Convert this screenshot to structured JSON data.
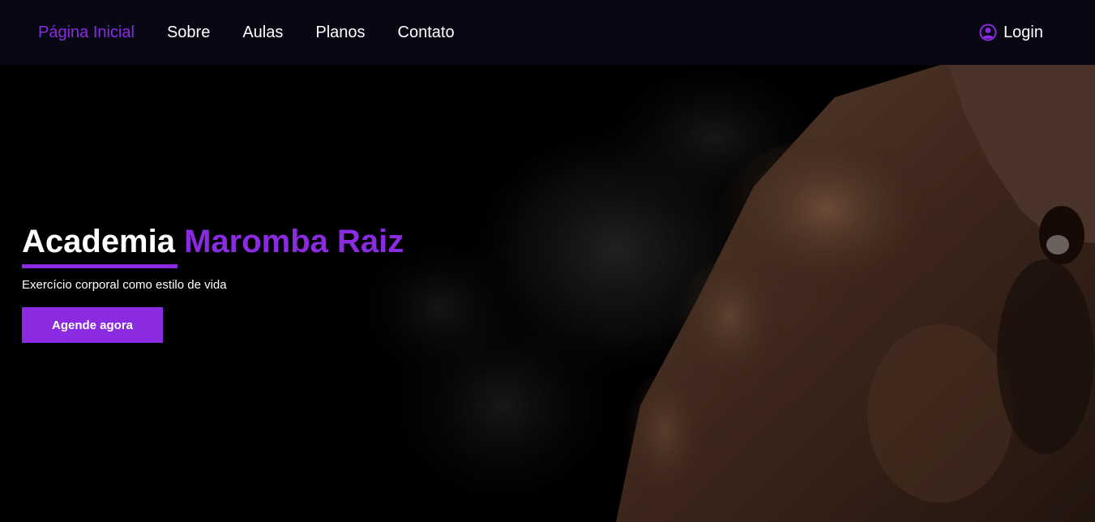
{
  "nav": {
    "items": [
      {
        "label": "Página Inicial",
        "active": true
      },
      {
        "label": "Sobre",
        "active": false
      },
      {
        "label": "Aulas",
        "active": false
      },
      {
        "label": "Planos",
        "active": false
      },
      {
        "label": "Contato",
        "active": false
      }
    ],
    "login_label": "Login",
    "login_icon": "user-circle-icon"
  },
  "hero": {
    "title_main": "Academia",
    "title_accent": "Maromba Raiz",
    "subtitle": "Exercício corporal como estilo de vida",
    "cta_label": "Agende agora",
    "image": "muscular-man-shouting-photo"
  },
  "colors": {
    "accent": "#8a2be2",
    "navbar_bg": "#070814",
    "hero_bg": "#000000",
    "text": "#ffffff"
  }
}
